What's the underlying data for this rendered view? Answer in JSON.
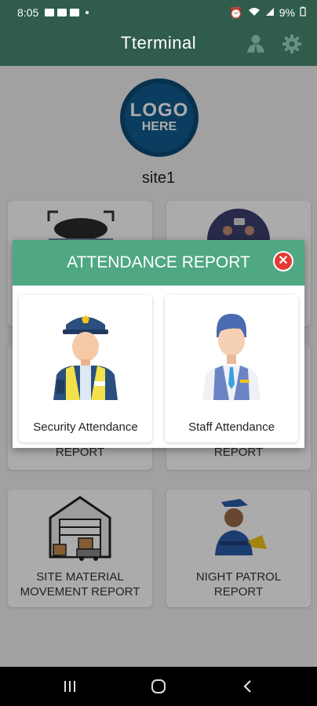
{
  "status_bar": {
    "time": "8:05",
    "battery": "9%"
  },
  "app_bar": {
    "title": "Tterminal"
  },
  "logo": {
    "line1": "LOGO",
    "line2": "HERE"
  },
  "site": {
    "name": "site1"
  },
  "cards": [
    {
      "label_line1": "",
      "label_line2": "REPORT"
    },
    {
      "label_line1": "",
      "label_line2": "REPORT"
    },
    {
      "label_line1": "SITE MATERIAL",
      "label_line2": "MOVEMENT REPORT"
    },
    {
      "label_line1": "NIGHT PATROL",
      "label_line2": "REPORT"
    }
  ],
  "dialog": {
    "title": "ATTENDANCE REPORT",
    "options": [
      {
        "label": "Security Attendance"
      },
      {
        "label": "Staff Attendance"
      }
    ]
  },
  "colors": {
    "header": "#2f5c4b",
    "dialog_header": "#4fa882",
    "close": "#e53935"
  }
}
